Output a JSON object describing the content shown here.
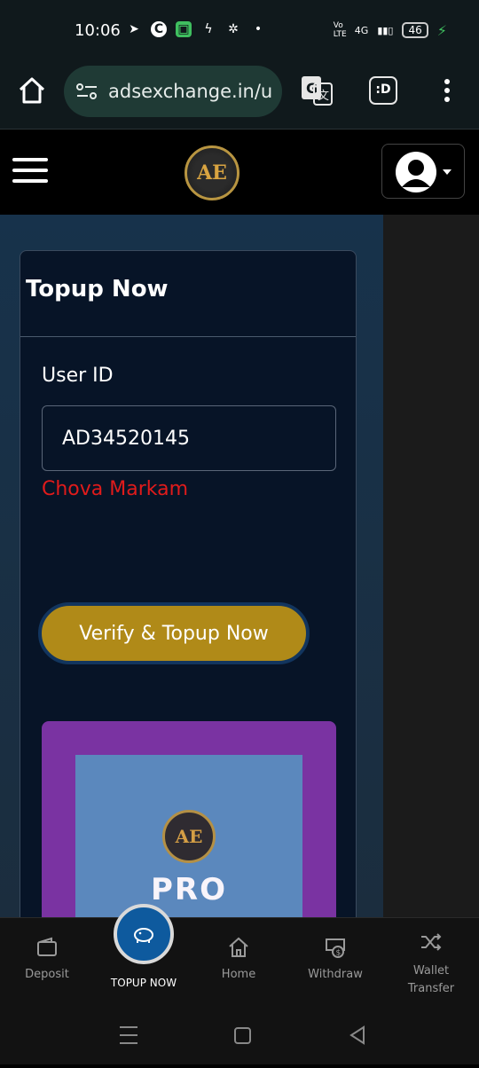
{
  "status_bar": {
    "time": "10:06",
    "network_label_1": "Vo LTE",
    "network_label_2": "4G",
    "battery": "46"
  },
  "browser": {
    "url": "adsexchange.in/u",
    "tabs_label": ":D"
  },
  "header": {
    "logo_text": "AE"
  },
  "card": {
    "title": "Topup Now",
    "user_id_label": "User ID",
    "user_id_value": "AD34520145",
    "user_name": "Chova Markam",
    "verify_button": "Verify & Topup Now"
  },
  "promo": {
    "logo_text": "AE",
    "text": "PRO"
  },
  "bottom_nav": {
    "items": [
      {
        "label": "Deposit",
        "icon": "wallet-icon"
      },
      {
        "label": "TOPUP NOW",
        "icon": "piggy-bank-icon"
      },
      {
        "label": "Home",
        "icon": "home-icon"
      },
      {
        "label": "Withdraw",
        "icon": "cash-icon"
      },
      {
        "label": "Wallet Transfer",
        "icon": "shuffle-icon"
      }
    ]
  },
  "colors": {
    "accent_gold": "#b08a18",
    "error_red": "#e01b1b",
    "promo_purple": "#7a33a2",
    "nav_center_blue": "#0e5a9e"
  }
}
